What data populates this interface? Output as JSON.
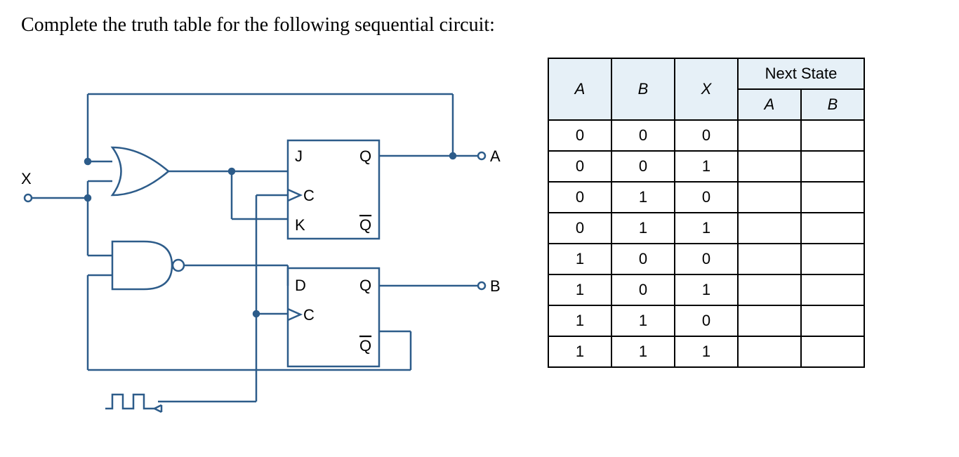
{
  "prompt": "Complete the truth table for the following sequential circuit:",
  "circuit": {
    "input_label": "X",
    "output_a": "A",
    "output_b": "B",
    "jk_ff": {
      "j": "J",
      "q": "Q",
      "c": "C",
      "k": "K",
      "qbar": "Q"
    },
    "d_ff": {
      "d": "D",
      "q": "Q",
      "c": "C",
      "qbar": "Q"
    }
  },
  "table": {
    "next_state_header": "Next State",
    "col_a": "A",
    "col_b": "B",
    "col_x": "X",
    "col_na": "A",
    "col_nb": "B",
    "rows": [
      {
        "a": "0",
        "b": "0",
        "x": "0",
        "na": "",
        "nb": ""
      },
      {
        "a": "0",
        "b": "0",
        "x": "1",
        "na": "",
        "nb": ""
      },
      {
        "a": "0",
        "b": "1",
        "x": "0",
        "na": "",
        "nb": ""
      },
      {
        "a": "0",
        "b": "1",
        "x": "1",
        "na": "",
        "nb": ""
      },
      {
        "a": "1",
        "b": "0",
        "x": "0",
        "na": "",
        "nb": ""
      },
      {
        "a": "1",
        "b": "0",
        "x": "1",
        "na": "",
        "nb": ""
      },
      {
        "a": "1",
        "b": "1",
        "x": "0",
        "na": "",
        "nb": ""
      },
      {
        "a": "1",
        "b": "1",
        "x": "1",
        "na": "",
        "nb": ""
      }
    ]
  }
}
